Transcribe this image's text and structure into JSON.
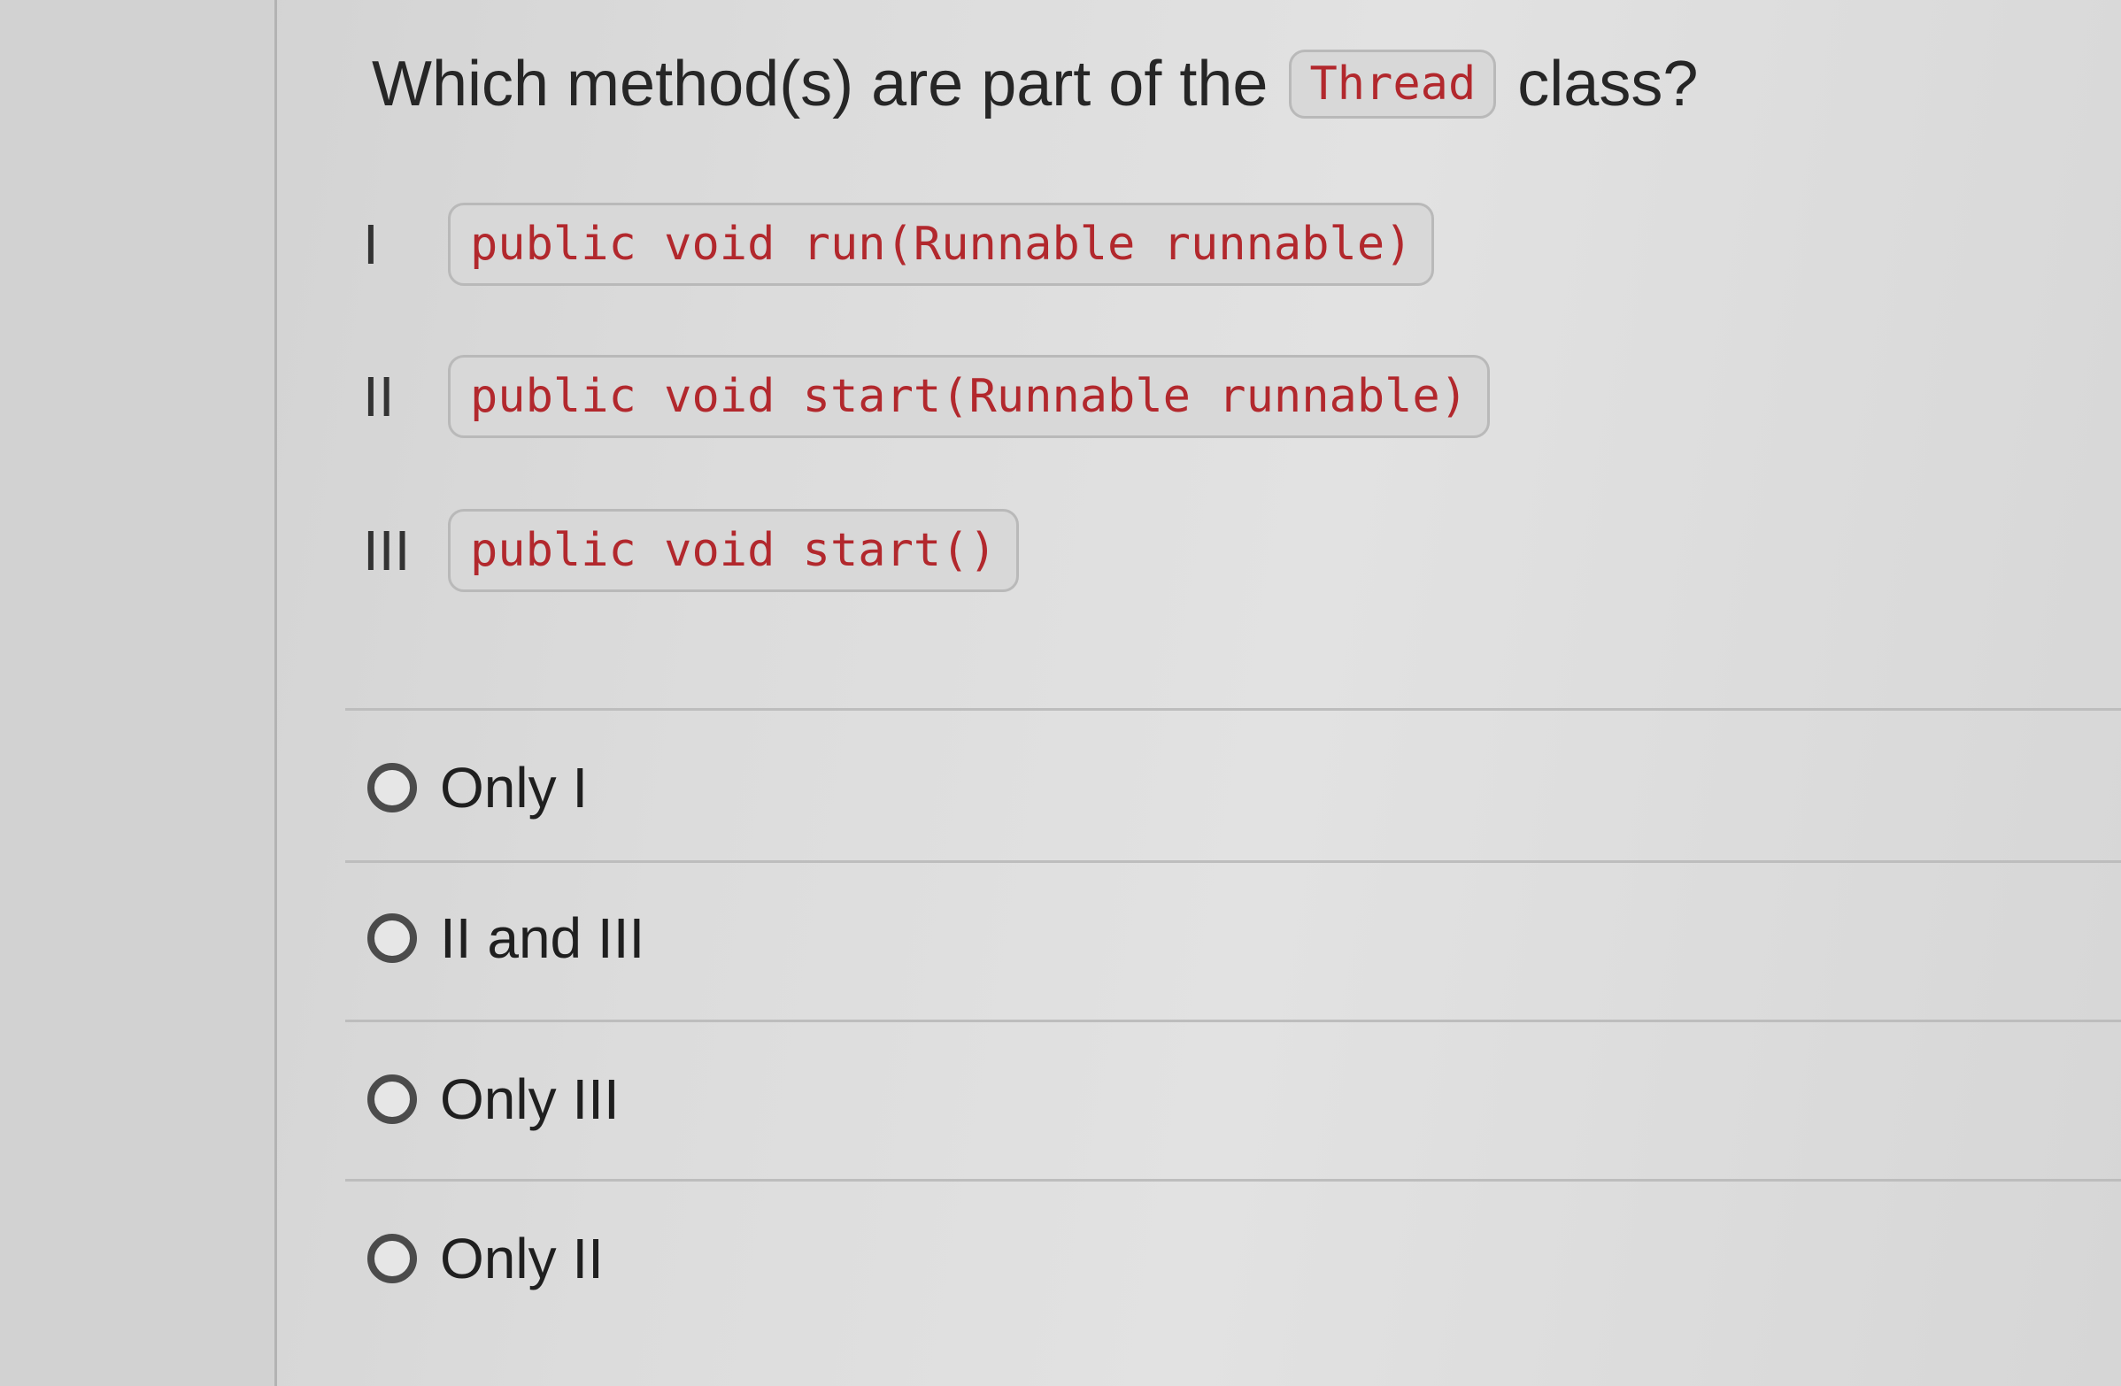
{
  "question": {
    "prefix": "Which method(s) are part of the",
    "code_term": "Thread",
    "suffix": "class?"
  },
  "statements": [
    {
      "numeral": "I",
      "code": "public void run(Runnable runnable)"
    },
    {
      "numeral": "II",
      "code": "public void start(Runnable runnable)"
    },
    {
      "numeral": "III",
      "code": "public void start()"
    }
  ],
  "options": [
    {
      "label": "Only I",
      "selected": false
    },
    {
      "label": "II and III",
      "selected": false
    },
    {
      "label": "Only III",
      "selected": false
    },
    {
      "label": "Only II",
      "selected": false
    }
  ],
  "colors": {
    "code_text": "#b2282d",
    "code_background": "#d8d8d8",
    "radio_border": "#4b4b4b"
  }
}
